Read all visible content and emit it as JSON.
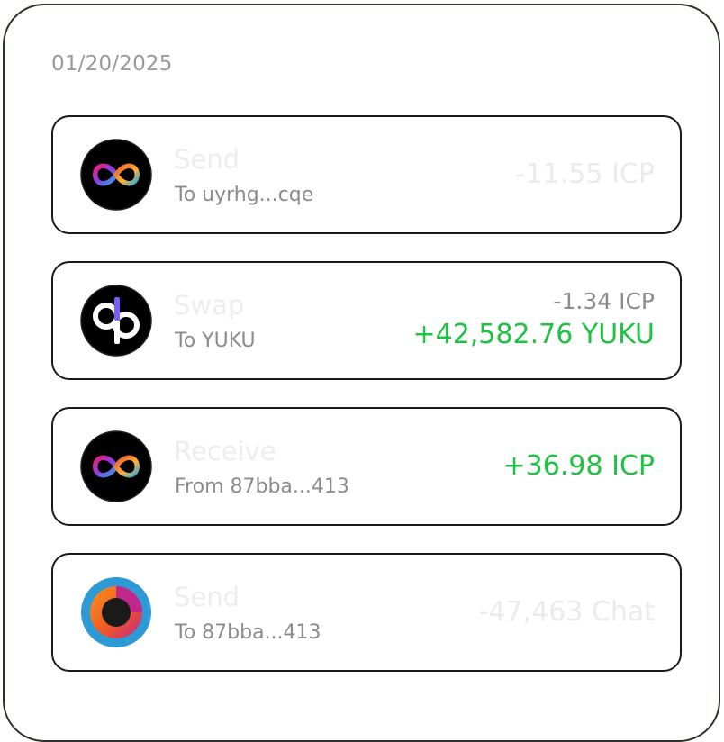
{
  "date": "01/20/2025",
  "colors": {
    "positive": "#1fc243",
    "muted_amount": "#ebebeb",
    "card_border": "#1a1a1a"
  },
  "transactions": [
    {
      "icon": "icp-token-icon",
      "title": "Send",
      "subtitle": "To uyrhg...cqe",
      "amount": "-11.55 ICP"
    },
    {
      "icon": "swap-token-icon",
      "title": "Swap",
      "subtitle": "To YUKU",
      "amount_from": "-1.34 ICP",
      "amount_to": "+42,582.76 YUKU"
    },
    {
      "icon": "icp-token-icon",
      "title": "Receive",
      "subtitle": "From 87bba...413",
      "amount": "+36.98 ICP"
    },
    {
      "icon": "chat-token-icon",
      "title": "Send",
      "subtitle": "To 87bba...413",
      "amount": "-47,463 Chat"
    }
  ]
}
